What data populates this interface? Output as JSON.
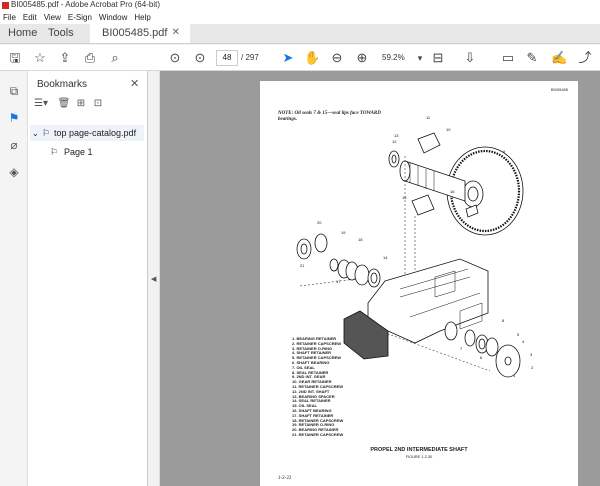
{
  "window": {
    "title": "BI005485.pdf - Adobe Acrobat Pro (64-bit)"
  },
  "menu": [
    "File",
    "Edit",
    "View",
    "E-Sign",
    "Window",
    "Help"
  ],
  "tabs": {
    "home": "Home",
    "tools": "Tools",
    "doc": "BI005485.pdf"
  },
  "toolbar": {
    "page_current": "48",
    "page_total": "/ 297",
    "zoom": "59.2%"
  },
  "bookmarks": {
    "title": "Bookmarks",
    "items": [
      {
        "label": "top page-catalog.pdf"
      },
      {
        "label": "Page 1"
      }
    ]
  },
  "document": {
    "doc_id": "BI005485",
    "note": "NOTE:   Oil seals 7 & 15—seal lips face TOWARD bearings.",
    "legend": [
      "1.  BEARING RETAINER",
      "2.  RETAINER CAPSCREW",
      "3.  RETAINER O-RING",
      "4.  SHAFT RETAINER",
      "5.  RETAINER CAPSCREW",
      "6.  SHAFT BEARING",
      "7.  OIL SEAL",
      "8.  SEAL RETAINER",
      "9.  2ND INT. GEAR",
      "10.  GEAR RETAINER",
      "11.  RETAINER CAPSCREW",
      "12.  2ND INT. SHAFT",
      "13.  BEARING SPACER",
      "14.  SEAL RETAINER",
      "15.  OIL SEAL",
      "16.  SHAFT BEARING",
      "17.  SHAFT RETAINER",
      "18.  RETAINER CAPSCREW",
      "19.  RETAINER O-RING",
      "20.  BEARING RETAINER",
      "21.  RETAINER CAPSCREW"
    ],
    "figure_title": "PROPEL 2ND INTERMEDIATE SHAFT",
    "figure_subtitle": "FIGURE 1-2-30",
    "page_number": "1-2-22",
    "callouts": [
      "11",
      "10",
      "13",
      "9",
      "12",
      "16",
      "15",
      "20",
      "18",
      "19",
      "21",
      "17",
      "14",
      "8",
      "7",
      "6",
      "5",
      "4",
      "3",
      "2",
      "1"
    ]
  },
  "colors": {
    "accent": "#1473e6",
    "pdf_red": "#d7261b",
    "doc_bg": "#9b9b9b"
  }
}
